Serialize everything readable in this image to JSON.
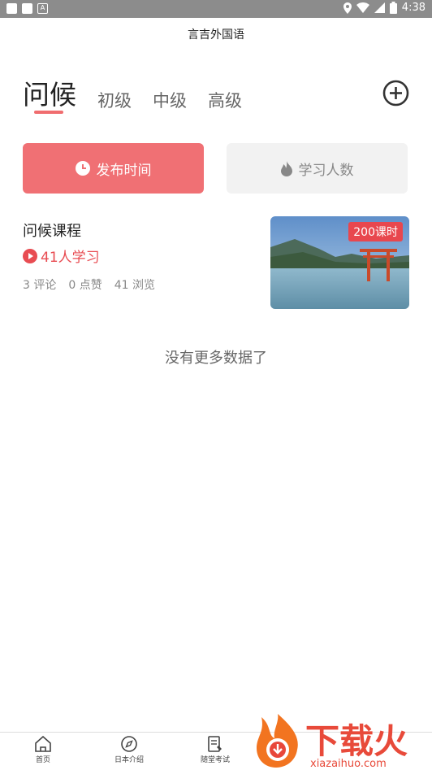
{
  "status_bar": {
    "time": "4:38",
    "notif_a": "A"
  },
  "app": {
    "title": "言吉外国语"
  },
  "tabs": [
    {
      "label": "问候",
      "active": true
    },
    {
      "label": "初级",
      "active": false
    },
    {
      "label": "中级",
      "active": false
    },
    {
      "label": "高级",
      "active": false
    }
  ],
  "sort": {
    "time_label": "发布时间",
    "people_label": "学习人数"
  },
  "course": {
    "title": "问候课程",
    "learners": "41人学习",
    "comments": "3 评论",
    "likes": "0 点赞",
    "views": "41 浏览",
    "badge": "200课时"
  },
  "list_end": "没有更多数据了",
  "bottom_nav": [
    {
      "label": "首页",
      "icon": "home-icon"
    },
    {
      "label": "日本介绍",
      "icon": "compass-icon"
    },
    {
      "label": "随堂考试",
      "icon": "exam-icon"
    }
  ],
  "watermark": {
    "text": "下载火",
    "url": "xiazaihuo.com"
  },
  "colors": {
    "accent": "#f07074",
    "accent_text": "#e84c52",
    "status_bar": "#8c8c8c"
  }
}
